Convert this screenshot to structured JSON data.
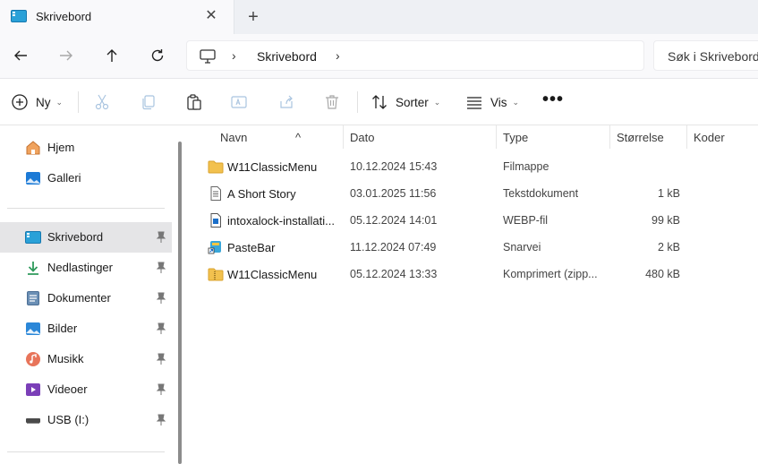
{
  "tab": {
    "title": "Skrivebord",
    "close": "✕",
    "new_tab": "+"
  },
  "address": {
    "crumb": "Skrivebord",
    "chevron": "›"
  },
  "search": {
    "placeholder": "Søk i Skrivebord"
  },
  "toolbar": {
    "new_label": "Ny",
    "sort_label": "Sorter",
    "view_label": "Vis",
    "more": "•••",
    "dropdown": "⌄"
  },
  "sidebar": {
    "items": [
      {
        "label": "Hjem",
        "icon": "home-icon"
      },
      {
        "label": "Galleri",
        "icon": "gallery-icon"
      },
      {
        "label": "Skrivebord",
        "icon": "desktop-icon",
        "selected": true
      },
      {
        "label": "Nedlastinger",
        "icon": "download-icon"
      },
      {
        "label": "Dokumenter",
        "icon": "documents-icon"
      },
      {
        "label": "Bilder",
        "icon": "pictures-icon"
      },
      {
        "label": "Musikk",
        "icon": "music-icon"
      },
      {
        "label": "Videoer",
        "icon": "videos-icon"
      },
      {
        "label": "USB (I:)",
        "icon": "usb-drive-icon"
      }
    ]
  },
  "columns": {
    "name": "Navn",
    "date": "Dato",
    "type": "Type",
    "size": "Størrelse",
    "tags": "Koder"
  },
  "files": [
    {
      "name": "W11ClassicMenu",
      "date": "10.12.2024 15:43",
      "type": "Filmappe",
      "size": "",
      "icon": "folder-icon"
    },
    {
      "name": "A Short Story",
      "date": "03.01.2025 11:56",
      "type": "Tekstdokument",
      "size": "1 kB",
      "icon": "text-file-icon"
    },
    {
      "name": "intoxalock-installati...",
      "date": "05.12.2024 14:01",
      "type": "WEBP-fil",
      "size": "99 kB",
      "icon": "image-file-icon"
    },
    {
      "name": "PasteBar",
      "date": "11.12.2024 07:49",
      "type": "Snarvei",
      "size": "2 kB",
      "icon": "shortcut-icon"
    },
    {
      "name": "W11ClassicMenu",
      "date": "05.12.2024 13:33",
      "type": "Komprimert (zipp...",
      "size": "480 kB",
      "icon": "zip-folder-icon"
    }
  ],
  "colors": {
    "folder": "#f2c14e",
    "selected_bg": "#e5e5e7",
    "accent": "#0078d4"
  }
}
